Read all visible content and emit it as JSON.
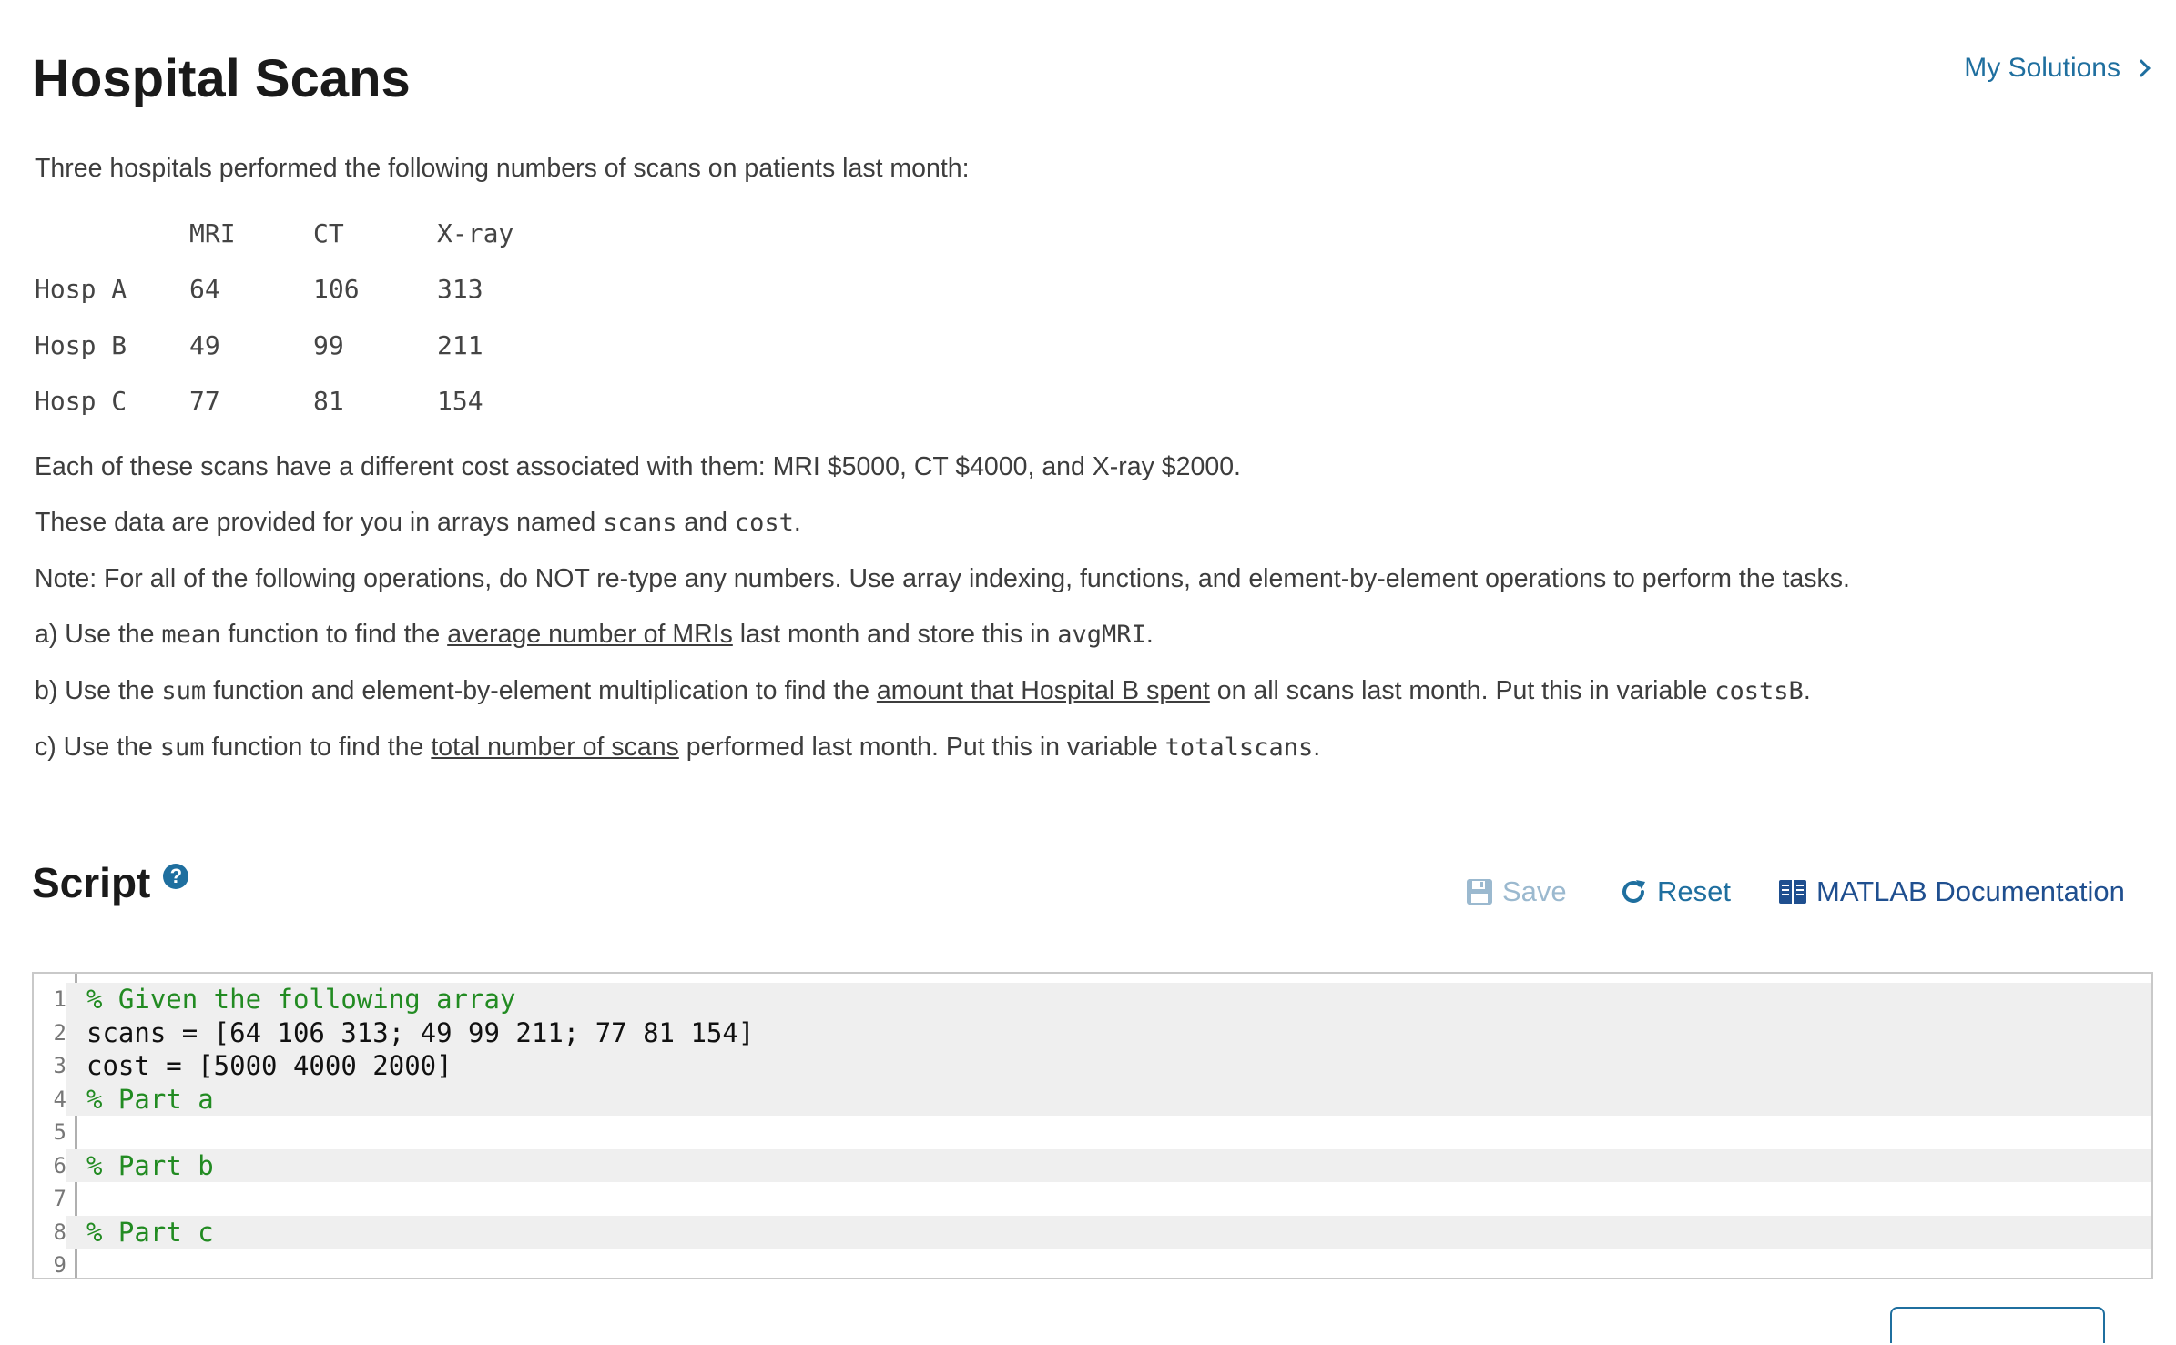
{
  "header": {
    "title": "Hospital Scans",
    "my_solutions": "My Solutions"
  },
  "problem": {
    "intro": "Three hospitals performed the following numbers of scans on patients last month:",
    "table": {
      "headers": [
        "",
        "MRI",
        "CT",
        "X-ray"
      ],
      "rows": [
        [
          "Hosp A",
          "64",
          "106",
          "313"
        ],
        [
          "Hosp B",
          "49",
          "99",
          "211"
        ],
        [
          "Hosp C",
          "77",
          "81",
          "154"
        ]
      ]
    },
    "costs": "Each of these scans have a different cost associated with them:  MRI $5000, CT $4000, and X-ray $2000.",
    "provided": {
      "pre": "These data are provided for you in arrays named ",
      "var1": "scans",
      "mid": " and ",
      "var2": "cost",
      "post": "."
    },
    "note": "Note: For all of the following operations, do NOT re-type any numbers.  Use array indexing, functions, and element-by-element operations to perform the tasks.",
    "task_a": {
      "p1": "a) Use the ",
      "fn": "mean",
      "p2": " function to find the ",
      "u": "average number of MRIs",
      "p3": " last month and store this in ",
      "var": "avgMRI",
      "p4": "."
    },
    "task_b": {
      "p1": "b) Use the ",
      "fn": "sum",
      "p2": " function and element-by-element multiplication to find the ",
      "u": "amount that Hospital B spent",
      "p3": " on all scans last month.  Put this in variable ",
      "var": "costsB",
      "p4": "."
    },
    "task_c": {
      "p1": "c) Use the ",
      "fn": "sum",
      "p2": " function to find the ",
      "u": "total number of scans",
      "p3": " performed last month.  Put this in variable ",
      "var": "totalscans",
      "p4": "."
    }
  },
  "script": {
    "title": "Script",
    "help_icon": "question-circle-icon",
    "toolbar": {
      "save": "Save",
      "reset": "Reset",
      "docs": "MATLAB Documentation"
    },
    "lines": [
      {
        "n": "1",
        "text": "% Given the following array"
      },
      {
        "n": "2",
        "text": "scans = [64 106 313; 49 99 211; 77 81 154]"
      },
      {
        "n": "3",
        "text": "cost = [5000 4000 2000]"
      },
      {
        "n": "4",
        "text": "% Part a"
      },
      {
        "n": "5",
        "text": ""
      },
      {
        "n": "6",
        "text": "% Part b"
      },
      {
        "n": "7",
        "text": ""
      },
      {
        "n": "8",
        "text": "% Part c"
      },
      {
        "n": "9",
        "text": ""
      }
    ]
  },
  "colors": {
    "link": "#1f6f9f",
    "comment": "#228b22",
    "save_disabled": "#9bb9cf"
  }
}
